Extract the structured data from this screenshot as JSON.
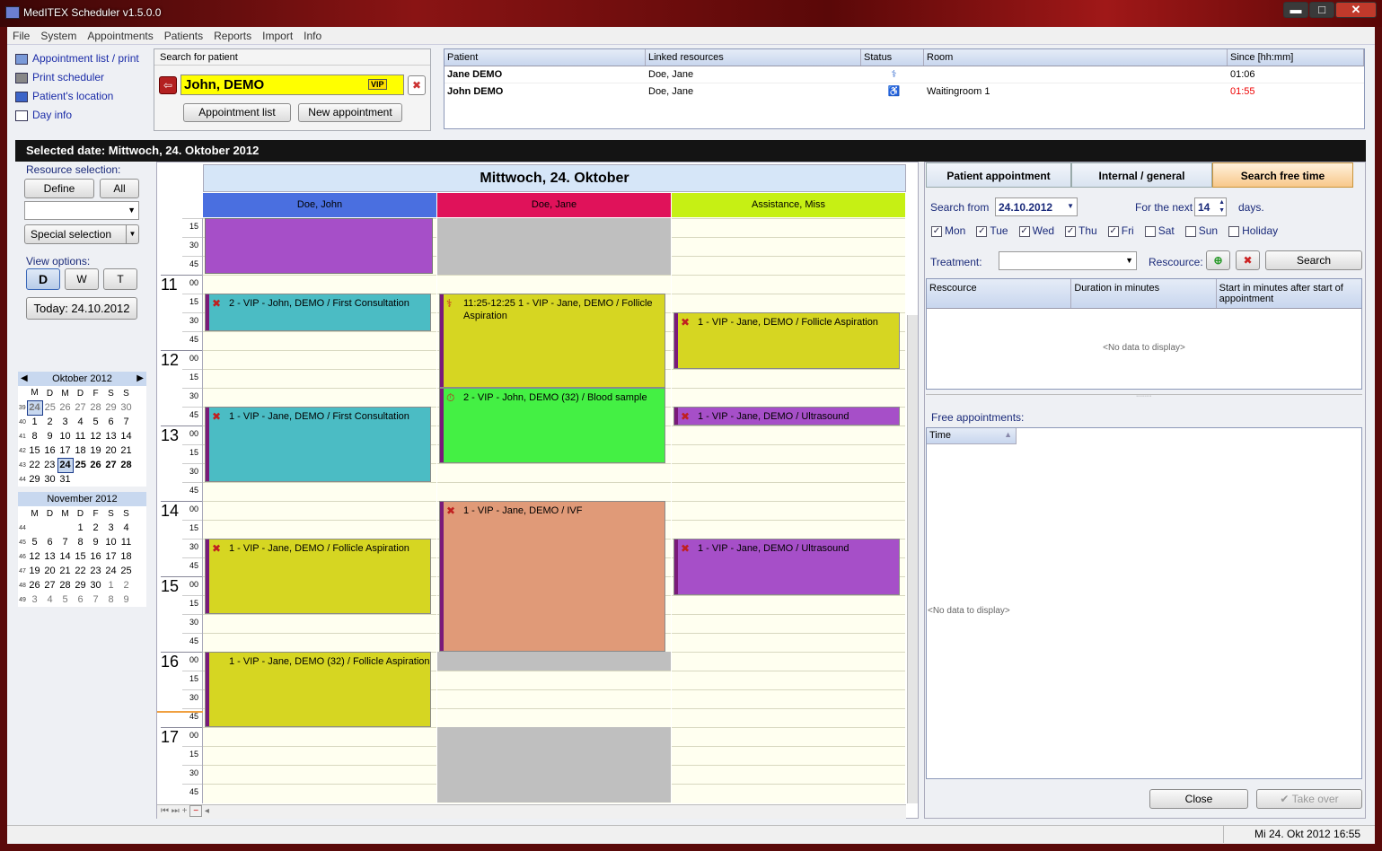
{
  "window": {
    "title": "MedITEX  Scheduler v1.5.0.0",
    "min": "▬",
    "max": "□",
    "close": "✕"
  },
  "menu": [
    "File",
    "System",
    "Appointments",
    "Patients",
    "Reports",
    "Import",
    "Info"
  ],
  "quicklinks": [
    "Appointment list / print",
    "Print scheduler",
    "Patient's location",
    "Day info"
  ],
  "patient_search": {
    "label": "Search for patient",
    "value": "John, DEMO",
    "badge": "VIP",
    "btn_list": "Appointment list",
    "btn_new": "New appointment"
  },
  "location_table": {
    "headers": [
      "Patient",
      "Linked resources",
      "Status",
      "Room",
      "Since [hh:mm]"
    ],
    "rows": [
      [
        "Jane DEMO",
        "Doe, Jane",
        "",
        "",
        "01:06"
      ],
      [
        "John DEMO",
        "Doe, Jane",
        "",
        "Waitingroom 1",
        "01:55"
      ]
    ]
  },
  "selected_date": "Selected date: Mittwoch, 24. Oktober 2012",
  "left": {
    "resource_label": "Resource selection:",
    "define": "Define",
    "all": "All",
    "special": "Special selection",
    "view_label": "View options:",
    "views": [
      "D",
      "W",
      "T"
    ],
    "today": "Today: 24.10.2012"
  },
  "cal1": {
    "title": "Oktober 2012",
    "dow": [
      "M",
      "D",
      "M",
      "D",
      "F",
      "S",
      "S"
    ],
    "weeks": [
      [
        "39",
        "24",
        "25",
        "26",
        "27",
        "28",
        "29",
        "30"
      ],
      [
        "40",
        "1",
        "2",
        "3",
        "4",
        "5",
        "6",
        "7"
      ],
      [
        "41",
        "8",
        "9",
        "10",
        "11",
        "12",
        "13",
        "14"
      ],
      [
        "42",
        "15",
        "16",
        "17",
        "18",
        "19",
        "20",
        "21"
      ],
      [
        "43",
        "22",
        "23",
        "24",
        "25",
        "26",
        "27",
        "28"
      ],
      [
        "44",
        "29",
        "30",
        "31",
        "",
        "",
        "",
        ""
      ]
    ]
  },
  "cal2": {
    "title": "November 2012",
    "dow": [
      "M",
      "D",
      "M",
      "D",
      "F",
      "S",
      "S"
    ],
    "weeks": [
      [
        "44",
        "",
        "",
        "",
        "1",
        "2",
        "3",
        "4"
      ],
      [
        "45",
        "5",
        "6",
        "7",
        "8",
        "9",
        "10",
        "11"
      ],
      [
        "46",
        "12",
        "13",
        "14",
        "15",
        "16",
        "17",
        "18"
      ],
      [
        "47",
        "19",
        "20",
        "21",
        "22",
        "23",
        "24",
        "25"
      ],
      [
        "48",
        "26",
        "27",
        "28",
        "29",
        "30",
        "1",
        "2"
      ],
      [
        "49",
        "3",
        "4",
        "5",
        "6",
        "7",
        "8",
        "9"
      ]
    ]
  },
  "day_title": "Mittwoch, 24. Oktober",
  "resources": [
    {
      "name": "Doe, John",
      "color": "#4a6fe0"
    },
    {
      "name": "Doe, Jane",
      "color": "#e0125a"
    },
    {
      "name": "Assistance, Miss",
      "color": "#c6f014"
    }
  ],
  "hours": [
    "11",
    "12",
    "13",
    "14",
    "15",
    "16",
    "17"
  ],
  "events": [
    {
      "text": "2 - VIP - John, DEMO / First Consultation"
    },
    {
      "text": "1 - VIP - Jane, DEMO / First Consultation"
    },
    {
      "text": "1 - VIP - Jane, DEMO / Follicle Aspiration"
    },
    {
      "text": "1 - VIP - Jane, DEMO (32) / Follicle Aspiration"
    },
    {
      "text": "11:25-12:25 1 - VIP - Jane, DEMO / Follicle Aspiration"
    },
    {
      "text": "2 - VIP - John, DEMO (32) / Blood sample"
    },
    {
      "text": "1 - VIP - Jane, DEMO / IVF"
    },
    {
      "text": "1 - VIP - Jane, DEMO / Follicle Aspiration"
    },
    {
      "text": "1 - VIP - Jane, DEMO / Ultrasound"
    },
    {
      "text": "1 - VIP - Jane, DEMO / Ultrasound"
    }
  ],
  "right": {
    "tabs": [
      "Patient appointment",
      "Internal / general",
      "Search free time"
    ],
    "search_from_label": "Search from",
    "search_from": "24.10.2012",
    "next_label": "For the next",
    "next_val": "14",
    "days": "days.",
    "weekdays": [
      {
        "d": "Mon",
        "c": true
      },
      {
        "d": "Tue",
        "c": true
      },
      {
        "d": "Wed",
        "c": true
      },
      {
        "d": "Thu",
        "c": true
      },
      {
        "d": "Fri",
        "c": true
      },
      {
        "d": "Sat",
        "c": false
      },
      {
        "d": "Sun",
        "c": false
      },
      {
        "d": "Holiday",
        "c": false
      }
    ],
    "treatment": "Treatment:",
    "resource_lbl": "Rescource:",
    "search_btn": "Search",
    "res_headers": [
      "Rescource",
      "Duration in minutes",
      "Start in minutes after start of appointment"
    ],
    "nodata": "<No data to display>",
    "free_label": "Free appointments:",
    "time_hdr": "Time",
    "close": "Close",
    "takeover": "Take over"
  },
  "status": "Mi 24. Okt 2012 16:55"
}
